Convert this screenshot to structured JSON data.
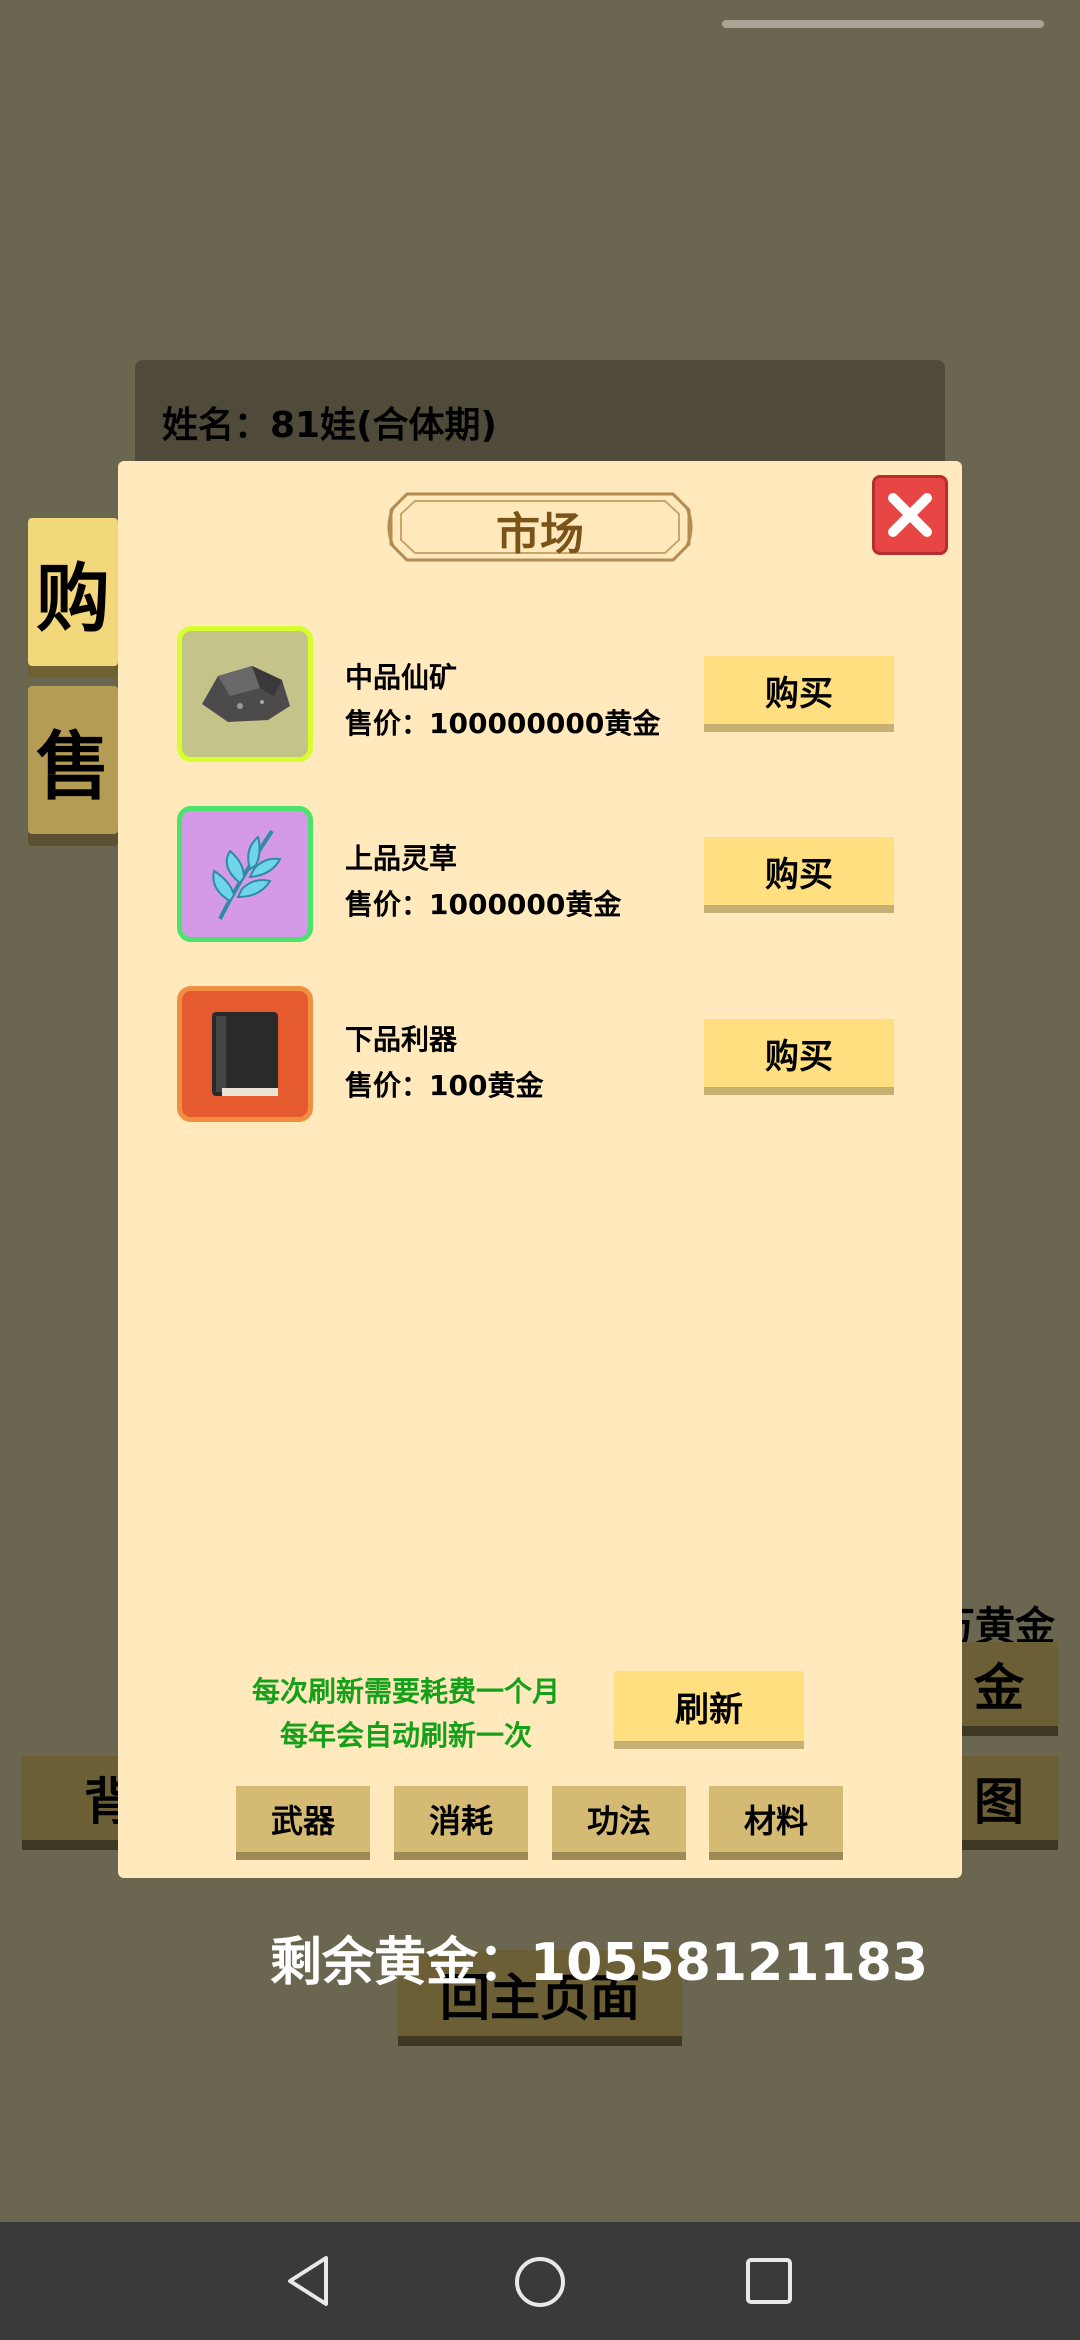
{
  "background": {
    "name_label": "姓名：81娃(合体期)",
    "side_tabs": [
      {
        "label": "购"
      },
      {
        "label": "售"
      }
    ],
    "partial_gold_text": "万黄金",
    "partial_btn_right_1": "金",
    "partial_btn_left": "背",
    "partial_btn_right_2": "图",
    "home_button": "回主页面"
  },
  "market": {
    "title": "市场",
    "close_icon": "close-icon",
    "items": [
      {
        "name": "中品仙矿",
        "price": "售价：100000000黄金",
        "buy_label": "购买",
        "icon": "ore-icon"
      },
      {
        "name": "上品灵草",
        "price": "售价：1000000黄金",
        "buy_label": "购买",
        "icon": "herb-icon"
      },
      {
        "name": "下品利器",
        "price": "售价：100黄金",
        "buy_label": "购买",
        "icon": "book-icon"
      }
    ],
    "refresh_note_1": "每次刷新需要耗费一个月",
    "refresh_note_2": "每年会自动刷新一次",
    "refresh_label": "刷新",
    "categories": [
      {
        "label": "武器"
      },
      {
        "label": "消耗"
      },
      {
        "label": "功法"
      },
      {
        "label": "材料"
      }
    ]
  },
  "gold_remaining": "剩余黄金：10558121183",
  "navbar": {
    "back_icon": "back-icon",
    "home_icon": "home-icon",
    "recents_icon": "recents-icon"
  },
  "colors": {
    "modal_bg": "#ffe9bd",
    "button": "#ffdf80",
    "title": "#7a5318",
    "note": "#15a019",
    "close": "#e84545"
  }
}
